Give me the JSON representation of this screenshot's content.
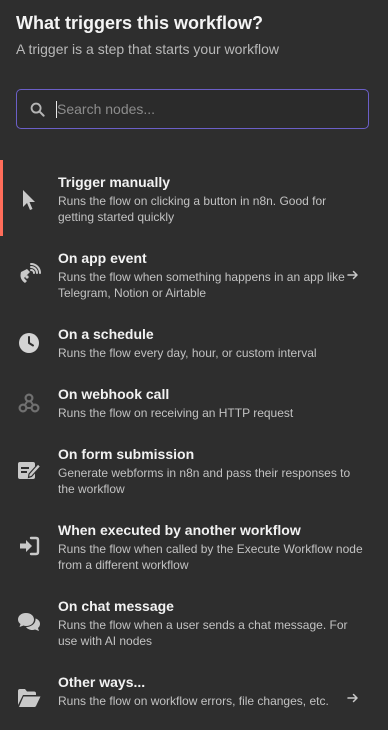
{
  "header": {
    "title": "What triggers this workflow?",
    "subtitle": "A trigger is a step that starts your workflow"
  },
  "search": {
    "placeholder": "Search nodes...",
    "value": ""
  },
  "colors": {
    "accent_active": "#ff6d5a",
    "search_border": "#6b5fc7",
    "background": "#2e2e2e"
  },
  "triggers": [
    {
      "title": "Trigger manually",
      "description": "Runs the flow on clicking a button in n8n. Good for getting started quickly",
      "icon": "mouse-pointer-icon",
      "active": true,
      "has_arrow": false
    },
    {
      "title": "On app event",
      "description": "Runs the flow when something happens in an app like Telegram, Notion or Airtable",
      "icon": "satellite-dish-icon",
      "active": false,
      "has_arrow": true
    },
    {
      "title": "On a schedule",
      "description": "Runs the flow every day, hour, or custom interval",
      "icon": "clock-icon",
      "active": false,
      "has_arrow": false
    },
    {
      "title": "On webhook call",
      "description": "Runs the flow on receiving an HTTP request",
      "icon": "webhook-icon",
      "active": false,
      "has_arrow": false
    },
    {
      "title": "On form submission",
      "description": "Generate webforms in n8n and pass their responses to the workflow",
      "icon": "form-edit-icon",
      "active": false,
      "has_arrow": false
    },
    {
      "title": "When executed by another workflow",
      "description": "Runs the flow when called by the Execute Workflow node from a different workflow",
      "icon": "sign-in-icon",
      "active": false,
      "has_arrow": false
    },
    {
      "title": "On chat message",
      "description": "Runs the flow when a user sends a chat message. For use with AI nodes",
      "icon": "chat-bubbles-icon",
      "active": false,
      "has_arrow": false
    },
    {
      "title": "Other ways...",
      "description": "Runs the flow on workflow errors, file changes, etc.",
      "icon": "folder-open-icon",
      "active": false,
      "has_arrow": true
    }
  ]
}
